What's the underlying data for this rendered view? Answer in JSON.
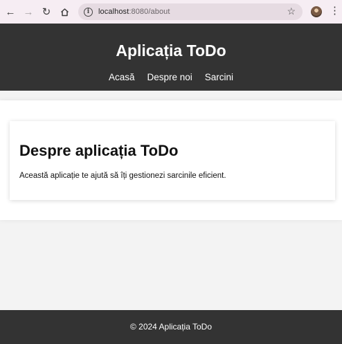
{
  "browser": {
    "url_host": "localhost",
    "url_rest": ":8080/about"
  },
  "header": {
    "title": "Aplicația ToDo",
    "nav": [
      {
        "label": "Acasă"
      },
      {
        "label": "Despre noi"
      },
      {
        "label": "Sarcini"
      }
    ]
  },
  "main": {
    "heading": "Despre aplicația ToDo",
    "text": "Această aplicație te ajută să îți gestionezi sarcinile eficient."
  },
  "footer": {
    "text": "© 2024 Aplicația ToDo"
  },
  "colors": {
    "header_bg": "#333333",
    "page_bg": "#f3f3f3",
    "card_bg": "#ffffff",
    "browser_bg": "#f6edf3"
  },
  "icons": [
    "back-icon",
    "forward-icon",
    "reload-icon",
    "home-icon",
    "site-info-icon",
    "bookmark-star-icon",
    "profile-avatar",
    "menu-kebab-icon"
  ]
}
